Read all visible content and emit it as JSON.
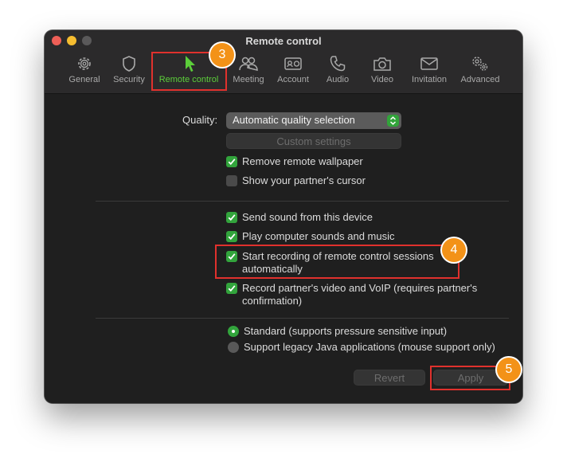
{
  "window": {
    "title": "Remote control"
  },
  "tabs": [
    {
      "label": "General",
      "icon": "gear-icon"
    },
    {
      "label": "Security",
      "icon": "shield-icon"
    },
    {
      "label": "Remote control",
      "icon": "cursor-arrow-icon",
      "active": true
    },
    {
      "label": "Meeting",
      "icon": "people-icon"
    },
    {
      "label": "Account",
      "icon": "id-card-icon"
    },
    {
      "label": "Audio",
      "icon": "phone-icon"
    },
    {
      "label": "Video",
      "icon": "camera-icon"
    },
    {
      "label": "Invitation",
      "icon": "envelope-icon"
    },
    {
      "label": "Advanced",
      "icon": "gears-icon"
    }
  ],
  "quality": {
    "label": "Quality:",
    "value": "Automatic quality selection",
    "custom_settings_label": "Custom settings"
  },
  "display_options": [
    {
      "label": "Remove remote wallpaper",
      "checked": true
    },
    {
      "label": "Show your partner's cursor",
      "checked": false
    }
  ],
  "audio_recording_options": [
    {
      "label": "Send sound from this device",
      "checked": true
    },
    {
      "label": "Play computer sounds and music",
      "checked": true
    },
    {
      "label": "Start recording of remote control sessions",
      "label_line2": "automatically",
      "checked": true
    },
    {
      "label": "Record partner's video and VoIP (requires partner's",
      "label_line2": "confirmation)",
      "checked": true
    }
  ],
  "input_mode": [
    {
      "label": "Standard (supports pressure sensitive input)",
      "selected": true
    },
    {
      "label": "Support legacy Java applications (mouse support only)",
      "selected": false
    }
  ],
  "buttons": {
    "revert": "Revert",
    "apply": "Apply"
  },
  "annotations": {
    "step3": "3",
    "step4": "4",
    "step5": "5"
  },
  "colors": {
    "accent_green": "#32a43c",
    "active_tab": "#5cce3a",
    "highlight_red": "#e0312d",
    "badge_orange": "#f39218"
  }
}
